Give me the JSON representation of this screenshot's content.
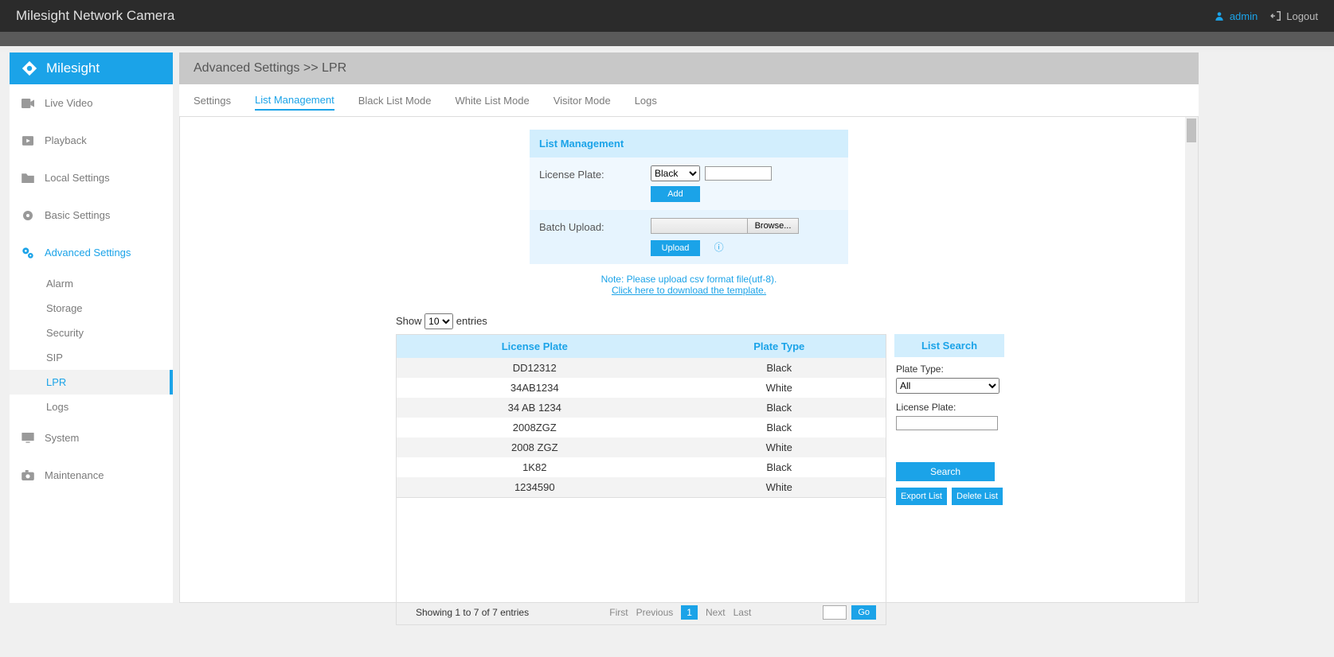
{
  "header": {
    "title": "Milesight Network Camera",
    "user": "admin",
    "logout": "Logout"
  },
  "sidebar": {
    "brand": "Milesight",
    "items": [
      {
        "label": "Live Video",
        "active": false
      },
      {
        "label": "Playback",
        "active": false
      },
      {
        "label": "Local Settings",
        "active": false
      },
      {
        "label": "Basic Settings",
        "active": false
      },
      {
        "label": "Advanced Settings",
        "active": true
      },
      {
        "label": "System",
        "active": false
      },
      {
        "label": "Maintenance",
        "active": false
      }
    ],
    "subitems": [
      {
        "label": "Alarm",
        "active": false
      },
      {
        "label": "Storage",
        "active": false
      },
      {
        "label": "Security",
        "active": false
      },
      {
        "label": "SIP",
        "active": false
      },
      {
        "label": "LPR",
        "active": true
      },
      {
        "label": "Logs",
        "active": false
      }
    ]
  },
  "breadcrumb": "Advanced Settings >> LPR",
  "tabs": [
    {
      "label": "Settings",
      "active": false
    },
    {
      "label": "List Management",
      "active": true
    },
    {
      "label": "Black List Mode",
      "active": false
    },
    {
      "label": "White List Mode",
      "active": false
    },
    {
      "label": "Visitor Mode",
      "active": false
    },
    {
      "label": "Logs",
      "active": false
    }
  ],
  "form": {
    "title": "List Management",
    "license_plate_label": "License Plate:",
    "type_select": "Black",
    "plate_input": "",
    "add_btn": "Add",
    "batch_upload_label": "Batch Upload:",
    "browse_btn": "Browse...",
    "upload_btn": "Upload",
    "note_line1": "Note: Please upload csv format file(utf-8).",
    "note_link": "Click here to download the template."
  },
  "entries": {
    "prefix": "Show",
    "value": "10",
    "suffix": "entries"
  },
  "table": {
    "headers": [
      "License Plate",
      "Plate Type"
    ],
    "rows": [
      {
        "plate": "DD12312",
        "type": "Black"
      },
      {
        "plate": "34AB1234",
        "type": "White"
      },
      {
        "plate": "34 AB 1234",
        "type": "Black"
      },
      {
        "plate": "2008ZGZ",
        "type": "Black"
      },
      {
        "plate": "2008 ZGZ",
        "type": "White"
      },
      {
        "plate": "1K82",
        "type": "Black"
      },
      {
        "plate": "1234590",
        "type": "White"
      }
    ],
    "footer_info": "Showing 1 to 7 of 7 entries",
    "pager": {
      "first": "First",
      "prev": "Previous",
      "current": "1",
      "next": "Next",
      "last": "Last",
      "go": "Go"
    }
  },
  "search": {
    "title": "List Search",
    "plate_type_label": "Plate Type:",
    "plate_type_value": "All",
    "license_plate_label": "License Plate:",
    "search_btn": "Search",
    "export_btn": "Export List",
    "delete_btn": "Delete List"
  }
}
